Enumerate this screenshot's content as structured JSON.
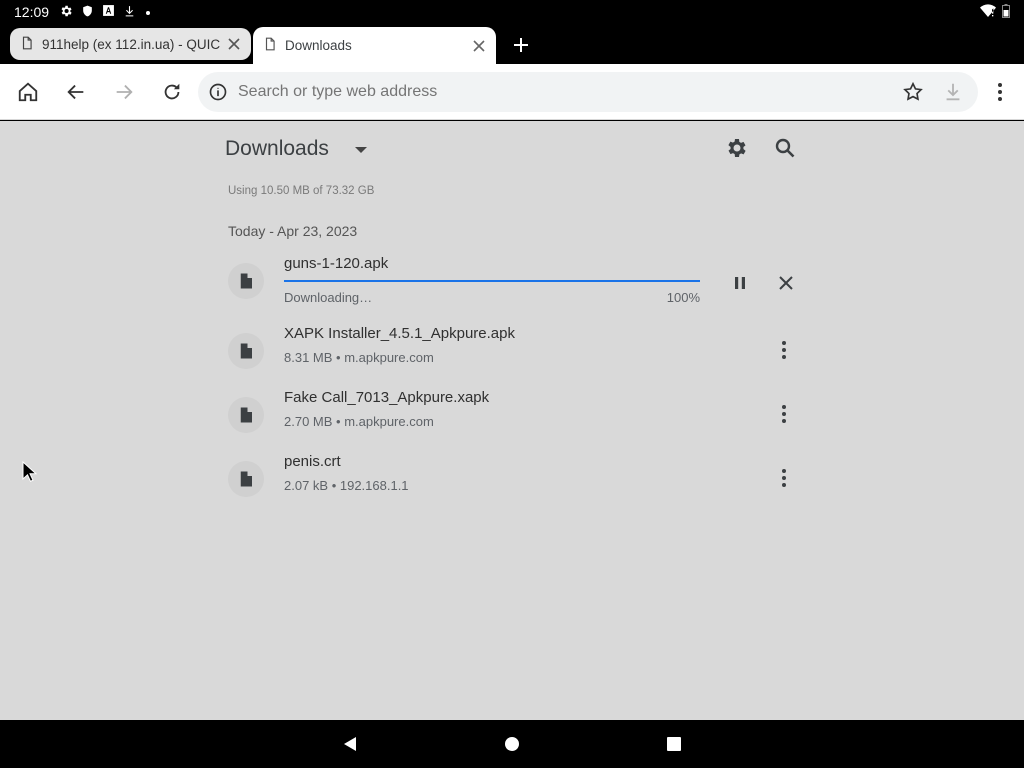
{
  "status_bar": {
    "time": "12:09",
    "icons": [
      "settings-icon",
      "shield-icon",
      "font-icon",
      "download-icon",
      "dot-icon"
    ],
    "right_icons": [
      "wifi-icon",
      "battery-icon"
    ]
  },
  "tabs": [
    {
      "title": "911help (ex 112.in.ua) - QUIC",
      "active": false
    },
    {
      "title": "Downloads",
      "active": true
    }
  ],
  "toolbar": {
    "url_placeholder": "Search or type web address"
  },
  "downloads": {
    "title": "Downloads",
    "storage": "Using 10.50 MB of 73.32 GB",
    "date_header": "Today - Apr 23, 2023",
    "active_item": {
      "name": "guns-1-120.apk",
      "status": "Downloading…",
      "percent_label": "100%",
      "progress": 1.0
    },
    "items": [
      {
        "name": "XAPK Installer_4.5.1_Apkpure.apk",
        "meta": "8.31 MB • m.apkpure.com"
      },
      {
        "name": "Fake Call_7013_Apkpure.xapk",
        "meta": "2.70 MB • m.apkpure.com"
      },
      {
        "name": "penis.crt",
        "meta": "2.07 kB • 192.168.1.1"
      }
    ]
  },
  "colors": {
    "accent": "#1a73e8",
    "content_bg": "#d9d9d9"
  }
}
